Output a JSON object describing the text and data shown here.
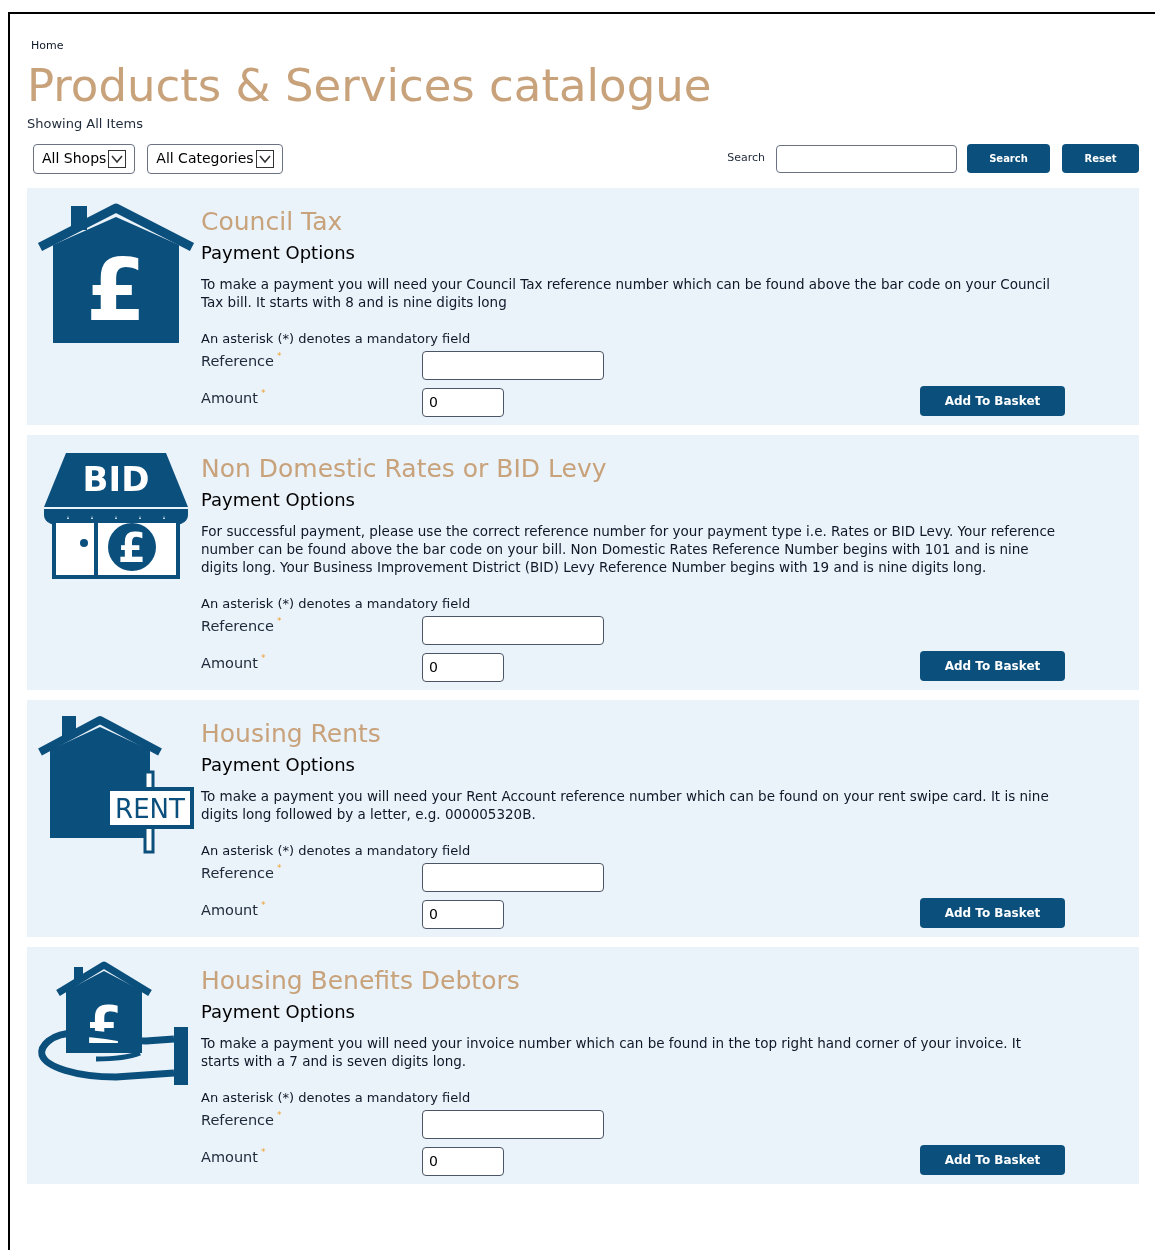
{
  "breadcrumb": "Home",
  "title": "Products & Services catalogue",
  "subtitle": "Showing All Items",
  "filters": [
    {
      "label": "All Shops"
    },
    {
      "label": "All Categories"
    }
  ],
  "search": {
    "label": "Search",
    "buttons": [
      "Search",
      "Reset"
    ]
  },
  "products": [
    {
      "title": "Council Tax",
      "subtitle": "Payment Options",
      "icon": {
        "kind": "house",
        "labels": [
          "£"
        ]
      },
      "description": "To make a payment you will need your Council Tax reference number which can be found above the bar code on your Council Tax bill. It starts with 8 and is nine digits long",
      "asterisk_note": "An asterisk (*) denotes a mandatory field",
      "fields": [
        {
          "kind": "text",
          "label": "Reference",
          "mark": "*"
        },
        {
          "kind": "amount",
          "label": "Amount",
          "mark": "*",
          "value": "0"
        }
      ],
      "button": "Add To Basket"
    },
    {
      "title": "Non Domestic Rates or BID Levy",
      "subtitle": "Payment Options",
      "icon": {
        "kind": "shop",
        "labels": [
          "BID",
          "£"
        ]
      },
      "description": "For successful payment, please use the correct reference number for your payment type i.e. Rates or BID Levy. Your reference number can be found above the bar code on your bill. Non Domestic Rates Reference Number begins with 101 and is nine digits long. Your Business Improvement District (BID) Levy Reference Number begins with 19 and is nine digits long.",
      "asterisk_note": "An asterisk (*) denotes a mandatory field",
      "fields": [
        {
          "kind": "text",
          "label": "Reference",
          "mark": "*"
        },
        {
          "kind": "amount",
          "label": "Amount",
          "mark": "*",
          "value": "0"
        }
      ],
      "button": "Add To Basket"
    },
    {
      "title": "Housing Rents",
      "subtitle": "Payment Options",
      "icon": {
        "kind": "rent",
        "labels": [
          "RENT"
        ]
      },
      "description": "To make a payment you will need your Rent Account reference number which can be found on your rent swipe card. It is nine digits long followed by a letter, e.g. 000005320B.",
      "asterisk_note": "An asterisk (*) denotes a mandatory field",
      "fields": [
        {
          "kind": "text",
          "label": "Reference",
          "mark": "*"
        },
        {
          "kind": "amount",
          "label": "Amount",
          "mark": "*",
          "value": "0"
        }
      ],
      "button": "Add To Basket"
    },
    {
      "title": "Housing Benefits Debtors",
      "subtitle": "Payment Options",
      "icon": {
        "kind": "hand",
        "labels": [
          "£"
        ]
      },
      "description": "To make a payment you will need your invoice number which can be found in the top right hand corner of your invoice. It starts with a 7 and is seven digits long.",
      "asterisk_note": "An asterisk (*) denotes a mandatory field",
      "fields": [
        {
          "kind": "text",
          "label": "Reference",
          "mark": "*"
        },
        {
          "kind": "amount",
          "label": "Amount",
          "mark": "*",
          "value": "0"
        }
      ],
      "button": "Add To Basket"
    }
  ]
}
